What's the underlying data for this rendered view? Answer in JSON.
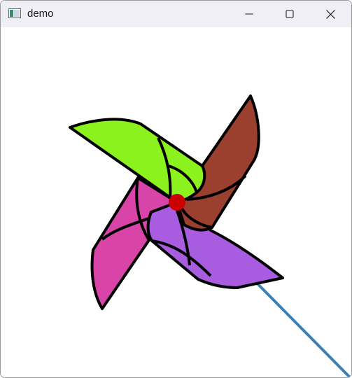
{
  "window": {
    "title": "demo"
  },
  "controls": {
    "minimize_icon": "minimize-icon",
    "maximize_icon": "maximize-icon",
    "close_icon": "close-icon"
  },
  "pinwheel": {
    "colors": {
      "top_blade": "#8bf21e",
      "right_blade": "#9b3f2e",
      "bottom_blade": "#a85ce0",
      "left_blade": "#d944a8",
      "hub": "#cc0000",
      "stick": "#3a80b8",
      "outline": "#000000"
    }
  }
}
